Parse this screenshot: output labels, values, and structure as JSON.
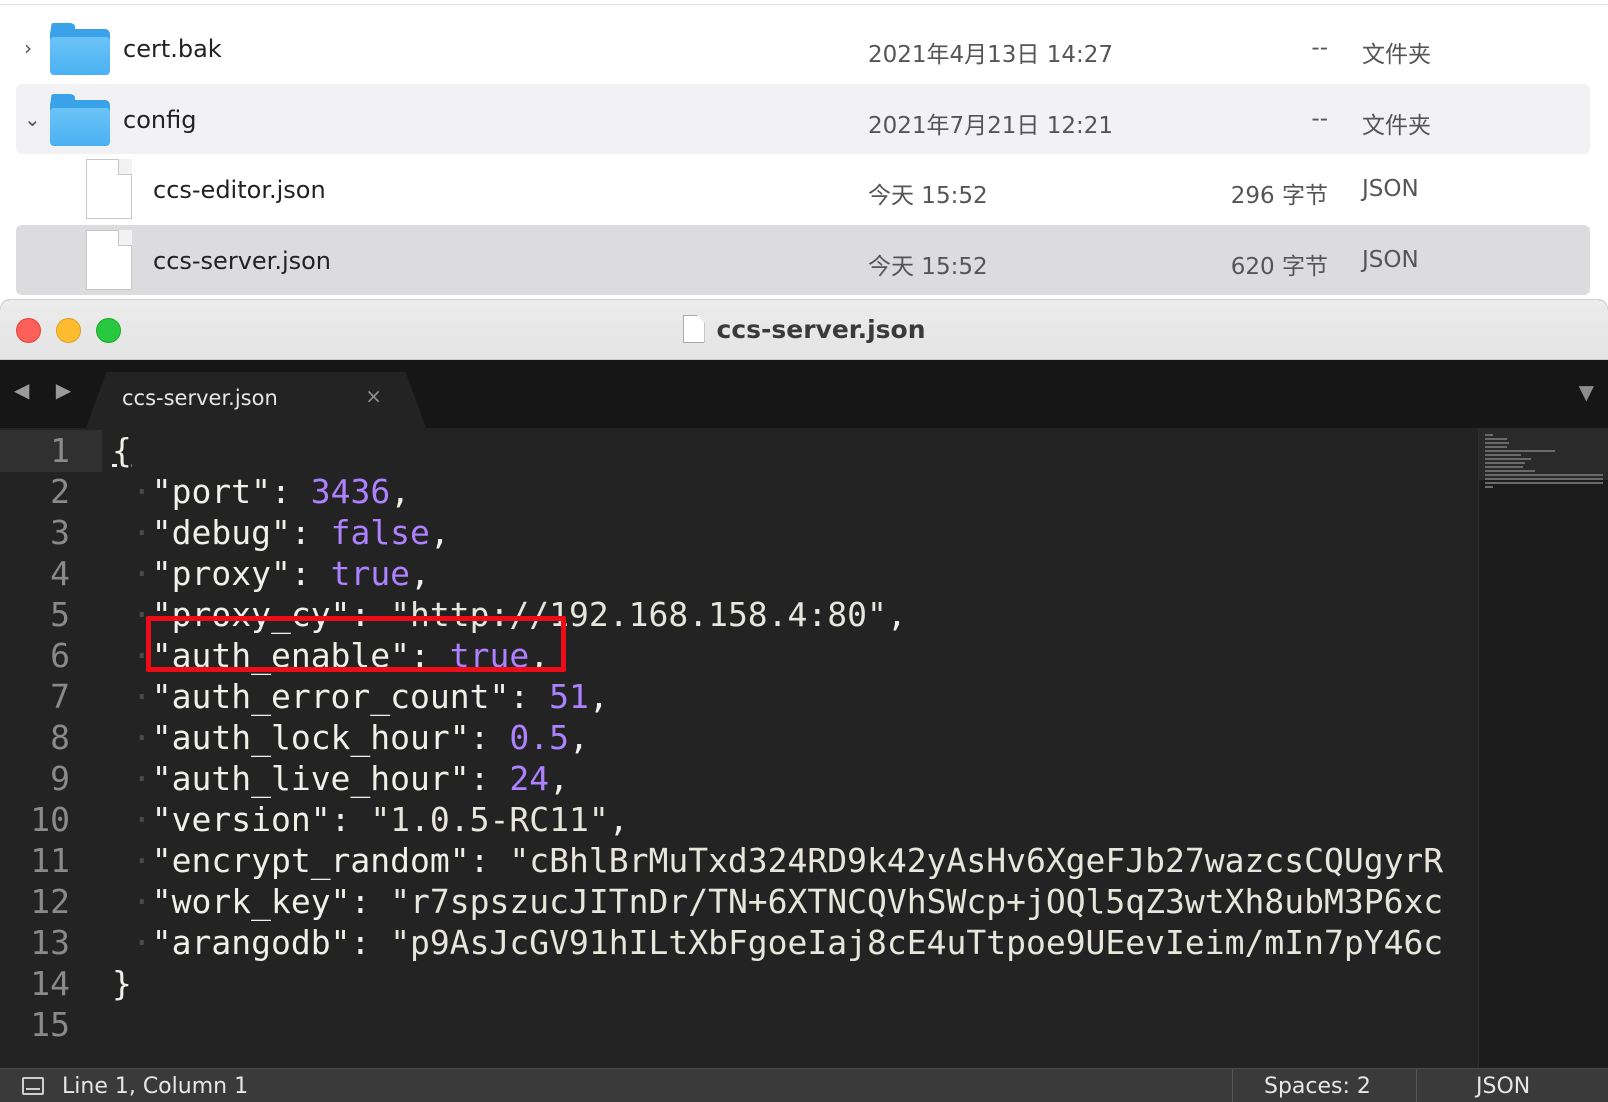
{
  "finder": {
    "rows": [
      {
        "name": "cert.bak",
        "date": "2021年4月13日 14:27",
        "size": "--",
        "kind": "文件夹",
        "disclosure": "›",
        "type": "folder"
      },
      {
        "name": "config",
        "date": "2021年7月21日 12:21",
        "size": "--",
        "kind": "文件夹",
        "disclosure": "⌄",
        "type": "folder"
      },
      {
        "name": "ccs-editor.json",
        "date": "今天 15:52",
        "size": "296 字节",
        "kind": "JSON",
        "type": "file"
      },
      {
        "name": "ccs-server.json",
        "date": "今天 15:52",
        "size": "620 字节",
        "kind": "JSON",
        "type": "file"
      }
    ]
  },
  "window": {
    "title": "ccs-server.json",
    "tab_label": "ccs-server.json",
    "tab_close": "×",
    "nav_arrows": "◀ ▶",
    "tab_menu": "▼"
  },
  "editor": {
    "line_numbers": [
      "1",
      "2",
      "3",
      "4",
      "5",
      "6",
      "7",
      "8",
      "9",
      "10",
      "11",
      "12",
      "13",
      "14",
      "15"
    ],
    "lines": [
      {
        "key": "",
        "sep": "",
        "value": "",
        "raw": "{"
      },
      {
        "key": "\"port\"",
        "sep": ": ",
        "value": "3436",
        "vtype": "num",
        "end": ","
      },
      {
        "key": "\"debug\"",
        "sep": ": ",
        "value": "false",
        "vtype": "bool",
        "end": ","
      },
      {
        "key": "\"proxy\"",
        "sep": ": ",
        "value": "true",
        "vtype": "bool",
        "end": ","
      },
      {
        "key": "\"proxy_cy\"",
        "sep": ": ",
        "value": "\"http://192.168.158.4:80\"",
        "vtype": "strv",
        "end": ","
      },
      {
        "key": "\"auth_enable\"",
        "sep": ": ",
        "value": "true",
        "vtype": "bool",
        "end": ","
      },
      {
        "key": "\"auth_error_count\"",
        "sep": ": ",
        "value": "51",
        "vtype": "num",
        "end": ","
      },
      {
        "key": "\"auth_lock_hour\"",
        "sep": ": ",
        "value": "0.5",
        "vtype": "num",
        "end": ","
      },
      {
        "key": "\"auth_live_hour\"",
        "sep": ": ",
        "value": "24",
        "vtype": "num",
        "end": ","
      },
      {
        "key": "\"version\"",
        "sep": ": ",
        "value": "\"1.0.5-RC11\"",
        "vtype": "strv",
        "end": ","
      },
      {
        "key": "\"encrypt_random\"",
        "sep": ": ",
        "value": "\"cBhlBrMuTxd324RD9k42yAsHv6XgeFJb27wazcsCQUgyrR",
        "vtype": "strv",
        "end": ""
      },
      {
        "key": "\"work_key\"",
        "sep": ": ",
        "value": "\"r7spszucJITnDr/TN+6XTNCQVhSWcp+jOQl5qZ3wtXh8ubM3P6xc",
        "vtype": "strv",
        "end": ""
      },
      {
        "key": "\"arangodb\"",
        "sep": ": ",
        "value": "\"p9AsJcGV91hILtXbFgoeIaj8cE4uTtpoe9UEevIeim/mIn7pY46c",
        "vtype": "strv",
        "end": ""
      },
      {
        "key": "",
        "sep": "",
        "value": "",
        "raw": "}"
      },
      {
        "key": "",
        "sep": "",
        "value": "",
        "raw": ""
      }
    ],
    "highlighted_line": 6,
    "colors": {
      "number": "#ae81ff",
      "text": "#f0f0ea",
      "highlight": "#ee0c18"
    }
  },
  "statusbar": {
    "position": "Line 1, Column 1",
    "spaces": "Spaces: 2",
    "syntax": "JSON"
  }
}
